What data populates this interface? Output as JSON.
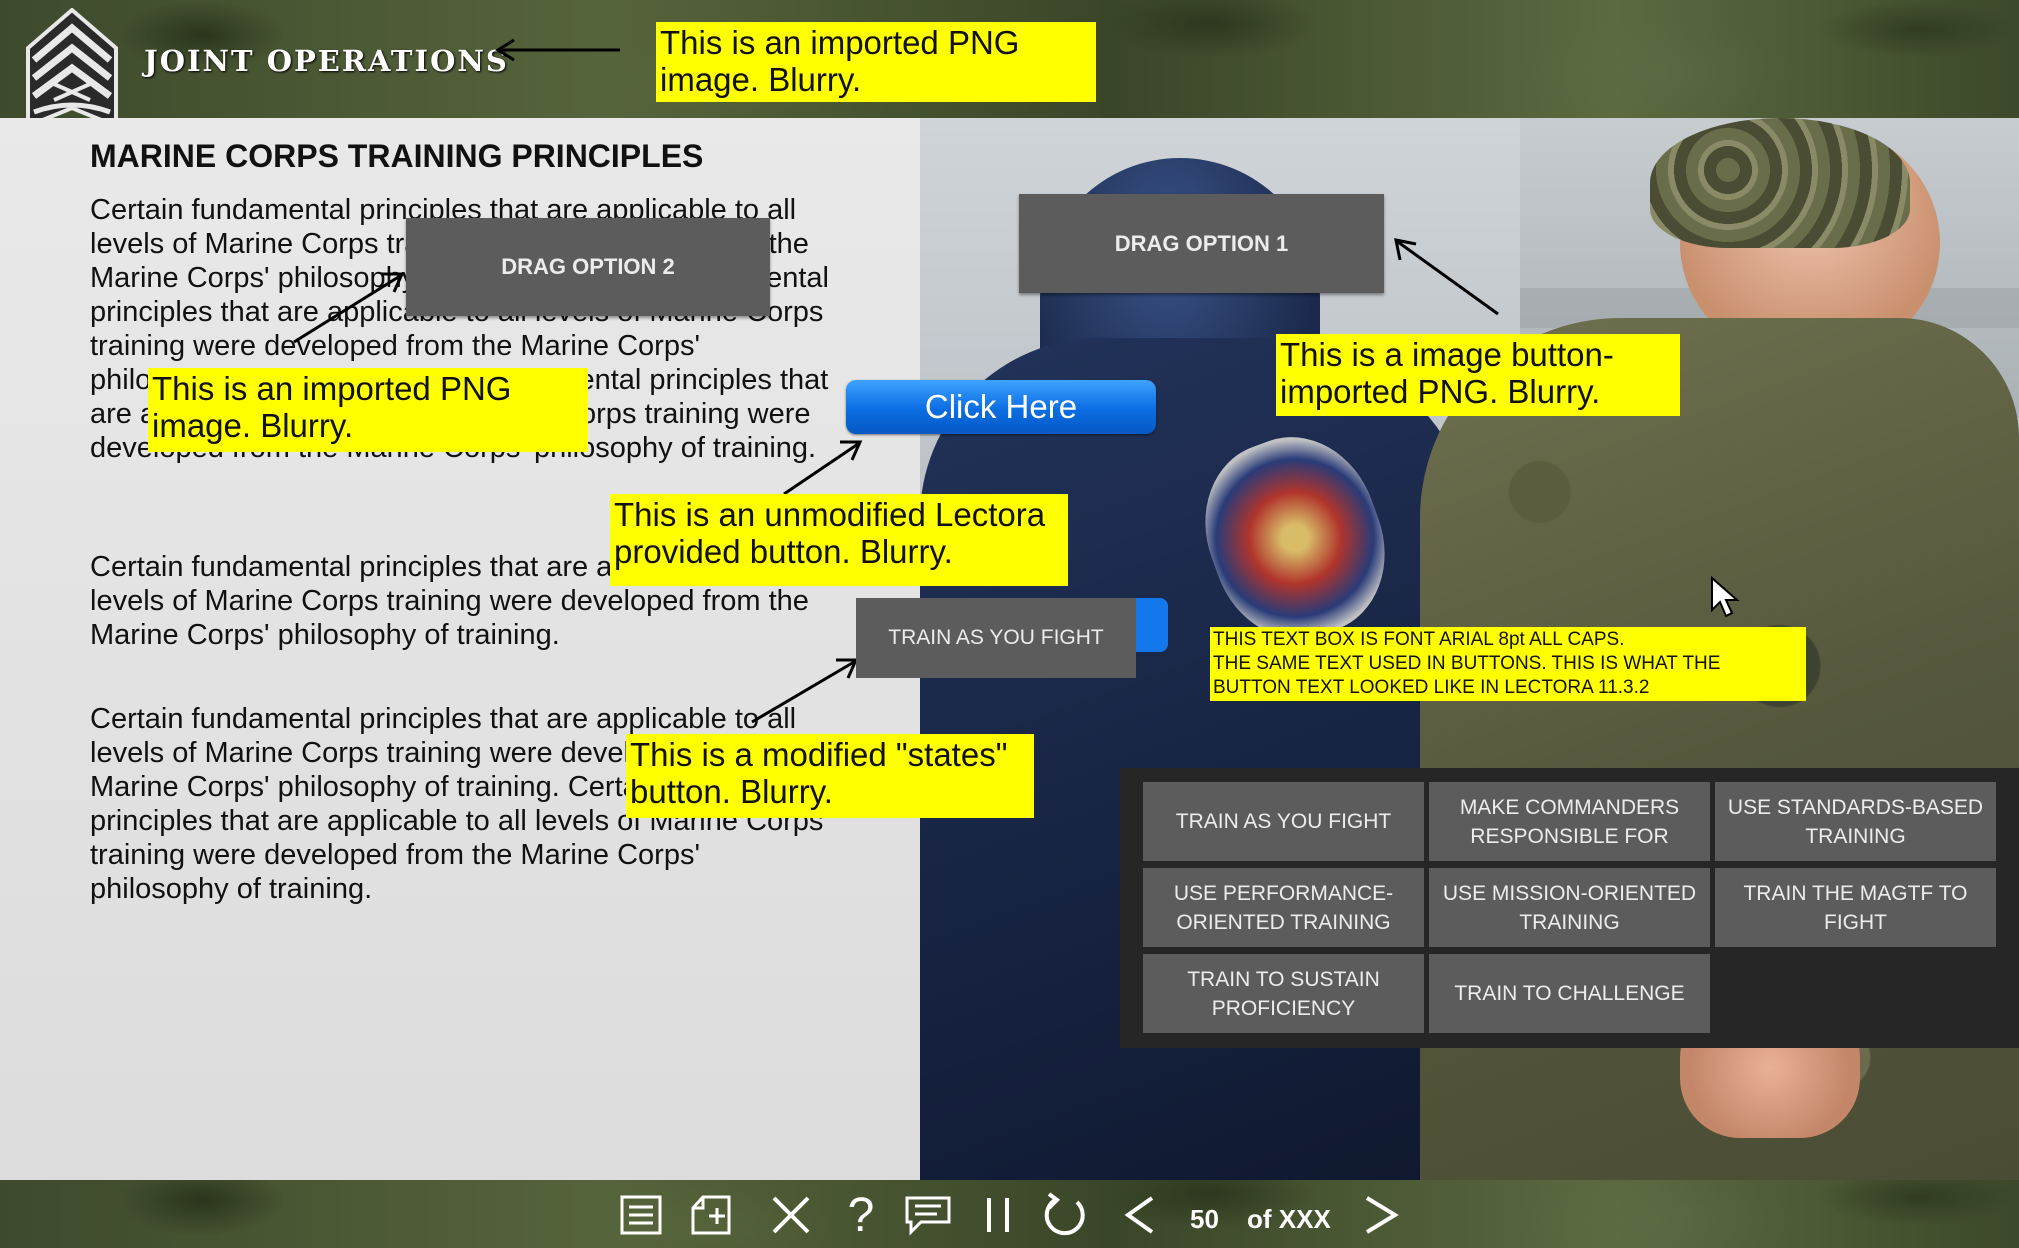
{
  "header": {
    "title": "JOINT OPERATIONS"
  },
  "content": {
    "heading": "MARINE CORPS TRAINING PRINCIPLES",
    "paragraphs": [
      "Certain fundamental principles that are applicable to all levels of Marine Corps training were developed from the Marine Corps' philosophy of training.  Certain fundamental principles that are applicable to all levels of Marine Corps training were developed from the Marine Corps' philosophy of training.  Certain fundamental principles that are applicable to all levels of Marine Corps training were developed from the Marine Corps' philosophy of training.",
      "Certain fundamental principles that are applicable to all levels of Marine Corps training were developed from the Marine Corps' philosophy of training.",
      "Certain fundamental principles that are applicable to all levels of Marine Corps training were developed from the Marine Corps' philosophy of training.  Certain fundamental principles that are applicable to all levels of Marine Corps training were developed from the Marine Corps' philosophy of training."
    ]
  },
  "buttons": {
    "drag_option_1": "DRAG OPTION 1",
    "drag_option_2": "DRAG OPTION 2",
    "click_here": "Click Here",
    "train_as_you_fight": "TRAIN AS YOU FIGHT"
  },
  "principles": [
    "TRAIN AS YOU FIGHT",
    "MAKE COMMANDERS RESPONSIBLE FOR",
    "USE STANDARDS-BASED TRAINING",
    "USE PERFORMANCE-ORIENTED TRAINING",
    "USE MISSION-ORIENTED TRAINING",
    "TRAIN THE MAGTF TO FIGHT",
    "TRAIN TO SUSTAIN PROFICIENCY",
    "TRAIN TO CHALLENGE"
  ],
  "callouts": {
    "header_png": "This is an imported PNG image.  Blurry.",
    "left_png": "This is an imported PNG image.  Blurry.",
    "image_button": "This is a image button-imported PNG. Blurry.",
    "lectora_button": "This is an unmodified Lectora provided button. Blurry.",
    "states_button": "This is a modified \"states\" button. Blurry.",
    "font_note_1": "THIS TEXT BOX IS FONT ARIAL 8pt ALL CAPS.",
    "font_note_2": "THE SAME TEXT USED IN BUTTONS. THIS IS WHAT THE BUTTON TEXT LOOKED LIKE IN LECTORA 11.3.2"
  },
  "footer": {
    "page_number": "50",
    "page_total": "of XXX",
    "icons": [
      "menu-icon",
      "bookmark-icon",
      "close-icon",
      "help-icon",
      "comment-icon",
      "pause-icon",
      "replay-icon",
      "previous-icon",
      "next-icon"
    ]
  },
  "colors": {
    "callout": "#ffff00",
    "button_gray": "#5c5c5c",
    "button_blue": "#0b6de3"
  }
}
